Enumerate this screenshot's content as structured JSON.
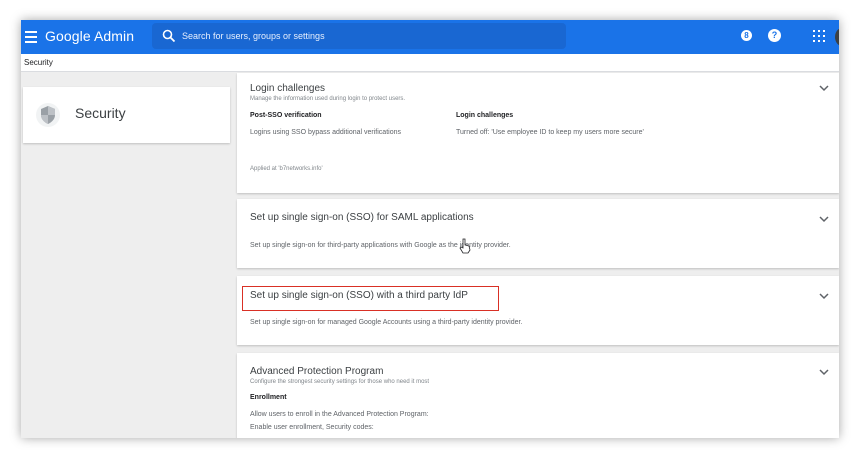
{
  "header": {
    "brand": "Google Admin",
    "search_placeholder": "Search for users, groups or settings",
    "notification_count": "8",
    "help_glyph": "?"
  },
  "breadcrumb": "Security",
  "sidebar": {
    "title": "Security",
    "icon": "shield-icon"
  },
  "cards": {
    "login": {
      "title": "Login challenges",
      "subtitle": "Manage the information used during login to protect users.",
      "col1_head": "Post-SSO verification",
      "col1_text": "Logins using SSO bypass additional verifications",
      "col2_head": "Login challenges",
      "col2_text": "Turned off: 'Use employee ID to keep my users more secure'",
      "applied": "Applied at 'b7networks.info'"
    },
    "saml": {
      "title": "Set up single sign-on (SSO) for SAML applications",
      "desc": "Set up single sign-on for third-party applications with Google as the identity provider."
    },
    "idp": {
      "title": "Set up single sign-on (SSO) with a third party IdP",
      "desc": "Set up single sign-on for managed Google Accounts using a third-party identity provider."
    },
    "app": {
      "title": "Advanced Protection Program",
      "subtitle": "Configure the strongest security settings for those who need it most",
      "enroll_head": "Enrollment",
      "enroll_text": "Allow users to enroll in the Advanced Protection Program: Enable user enrollment, Security codes:"
    }
  },
  "colors": {
    "topbar": "#1a73e8",
    "highlight": "#d93025",
    "background": "#eeeeee"
  }
}
